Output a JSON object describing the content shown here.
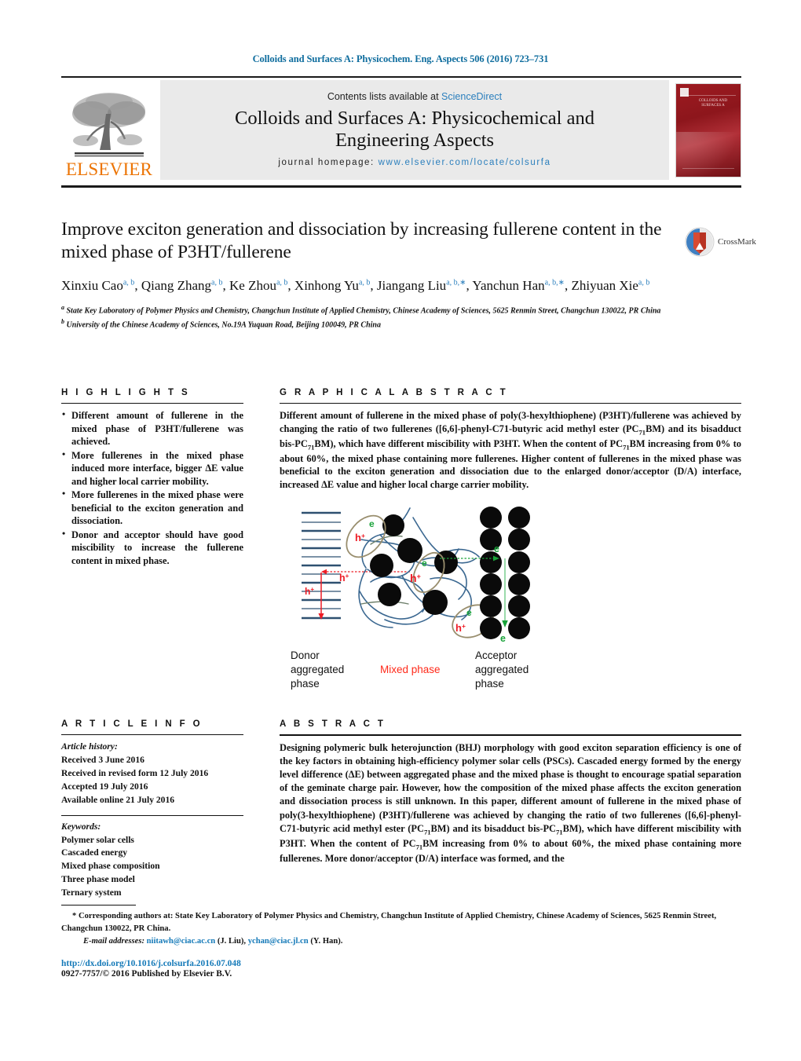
{
  "running_head": "Colloids and Surfaces A: Physicochem. Eng. Aspects 506 (2016) 723–731",
  "masthead": {
    "contents_prefix": "Contents lists available at ",
    "science_direct": "ScienceDirect",
    "journal_title_line1": "Colloids and Surfaces A: Physicochemical and",
    "journal_title_line2": "Engineering Aspects",
    "homepage_label": "journal homepage:",
    "homepage_url": "www.elsevier.com/locate/colsurfa",
    "publisher": "ELSEVIER",
    "cover_title": "COLLOIDS AND SURFACES A",
    "cover_sub": "Physicochemical and engineering aspects"
  },
  "article": {
    "title": "Improve exciton generation and dissociation by increasing fullerene content in the mixed phase of P3HT/fullerene",
    "authors": [
      {
        "name": "Xinxiu Cao",
        "marks": "a, b",
        "star": false,
        "sep": ", "
      },
      {
        "name": "Qiang Zhang",
        "marks": "a, b",
        "star": false,
        "sep": ", "
      },
      {
        "name": "Ke Zhou",
        "marks": "a, b",
        "star": false,
        "sep": ", "
      },
      {
        "name": "Xinhong Yu",
        "marks": "a, b",
        "star": false,
        "sep": ", "
      },
      {
        "name": "Jiangang Liu",
        "marks": "a, b,",
        "star": true,
        "sep": ", "
      },
      {
        "name": "Yanchun Han",
        "marks": "a, b,",
        "star": true,
        "sep": ", "
      },
      {
        "name": "Zhiyuan Xie",
        "marks": "a, b",
        "star": false,
        "sep": ""
      }
    ],
    "affiliations": [
      {
        "mark": "a",
        "text": "State Key Laboratory of Polymer Physics and Chemistry, Changchun Institute of Applied Chemistry, Chinese Academy of Sciences, 5625 Renmin Street, Changchun 130022, PR China"
      },
      {
        "mark": "b",
        "text": "University of the Chinese Academy of Sciences, No.19A Yuquan Road, Beijing 100049, PR China"
      }
    ],
    "crossmark_label": "CrossMark"
  },
  "highlights": {
    "heading": "H I G H L I G H T S",
    "items": [
      "Different amount of fullerene in the mixed phase of P3HT/fullerene was achieved.",
      "More fullerenes in the mixed phase induced more interface, bigger ΔE value and higher local carrier mobility.",
      "More fullerenes in the mixed phase were beneficial to the exciton generation and dissociation.",
      "Donor and acceptor should have good miscibility to increase the fullerene content in mixed phase."
    ]
  },
  "graphical_abstract": {
    "heading": "G R A P H I C A L   A B S T R A C T",
    "paragraph_parts": [
      {
        "t": "Different amount of fullerene in the mixed phase of poly(3-hexylthiophene) (P3HT)/fullerene was achieved by changing the ratio of two fullerenes ([6,6]-phenyl-C71-butyric acid methyl ester (PC"
      },
      {
        "sub": "71"
      },
      {
        "t": "BM) and its bisadduct bis-PC"
      },
      {
        "sub": "71"
      },
      {
        "t": "BM), which have different miscibility with P3HT. When the content of PC"
      },
      {
        "sub": "71"
      },
      {
        "t": "BM increasing from 0% to about 60%, the mixed phase containing more fullerenes. Higher content of fullerenes in the mixed phase was beneficial to the exciton generation and dissociation due to the enlarged donor/acceptor (D/A) interface, increased ΔE value and higher local charge carrier mobility."
      }
    ],
    "figure": {
      "donor_label": "Donor\naggregated\nphase",
      "donor_label_lines": [
        "Donor",
        "aggregated",
        "phase"
      ],
      "mixed_label": "Mixed phase",
      "acceptor_label_lines": [
        "Acceptor",
        "aggregated",
        "phase"
      ],
      "electron_symbol": "e",
      "hole_symbol": "h",
      "hole_superscript": "+",
      "colors": {
        "energy_levels": "#2e5070",
        "polymer_chains": "#3a6790",
        "fullerene": "#0a0a0a",
        "exciton_ellipse": "#998e6e",
        "hole_red": "#ee1c25",
        "electron_green": "#1aa33a",
        "mixed_label_red": "#ff2a1a"
      },
      "energy_level_count": 13,
      "acceptor_grid_rows": 6,
      "acceptor_grid_cols": 2,
      "mixed_phase_fullerene_count": 6
    }
  },
  "article_info": {
    "heading": "A R T I C L E   I N F O",
    "history_label": "Article history:",
    "history": [
      "Received 3 June 2016",
      "Received in revised form 12 July 2016",
      "Accepted 19 July 2016",
      "Available online 21 July 2016"
    ],
    "keywords_label": "Keywords:",
    "keywords": [
      "Polymer solar cells",
      "Cascaded energy",
      "Mixed phase composition",
      "Three phase model",
      "Ternary system"
    ]
  },
  "abstract": {
    "heading": "A B S T R A C T",
    "parts": [
      {
        "t": "Designing polymeric bulk heterojunction (BHJ) morphology with good exciton separation efficiency is one of the key factors in obtaining high-efficiency polymer solar cells (PSCs). Cascaded energy formed by the energy level difference (ΔE) between aggregated phase and the mixed phase is thought to encourage spatial separation of the geminate charge pair. However, how the composition of the mixed phase affects the exciton generation and dissociation process is still unknown. In this paper, different amount of fullerene in the mixed phase of poly(3-hexylthiophene) (P3HT)/fullerene was achieved by changing the ratio of two fullerenes ([6,6]-phenyl-C71-butyric acid methyl ester (PC"
      },
      {
        "sub": "71"
      },
      {
        "t": "BM) and its bisadduct bis-PC"
      },
      {
        "sub": "71"
      },
      {
        "t": "BM), which have different miscibility with P3HT. When the content of PC"
      },
      {
        "sub": "71"
      },
      {
        "t": "BM increasing from 0% to about 60%, the mixed phase containing more fullerenes. More donor/acceptor (D/A) interface was formed, and the"
      }
    ]
  },
  "footer": {
    "corresponding": "* Corresponding authors at: State Key Laboratory of Polymer Physics and Chemistry, Changchun Institute of Applied Chemistry, Chinese Academy of Sciences, 5625 Renmin Street, Changchun 130022, PR China.",
    "email_label": "E-mail addresses:",
    "email1": "niitawh@ciac.ac.cn",
    "email1_owner": "(J. Liu),",
    "email2": "ychan@ciac.jl.cn",
    "email2_owner": "(Y. Han).",
    "doi": "http://dx.doi.org/10.1016/j.colsurfa.2016.07.048",
    "issn": "0927-7757/© 2016 Published by Elsevier B.V."
  }
}
